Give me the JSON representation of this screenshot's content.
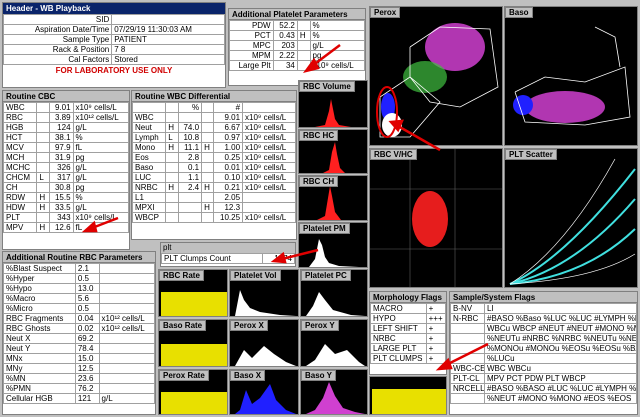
{
  "header": {
    "title": "Header - WB Playback",
    "rows": [
      {
        "label": "SID",
        "value": ""
      },
      {
        "label": "Aspiration Date/Time",
        "value": "07/29/19 11:30:03 AM"
      },
      {
        "label": "Sample Type",
        "value": "PATIENT"
      },
      {
        "label": "Rack & Position",
        "value": "7 8"
      },
      {
        "label": "Cal Factors",
        "value": "Stored"
      }
    ],
    "lab_only": "FOR LABORATORY USE ONLY"
  },
  "platelet_params": {
    "title": "Additional Platelet Parameters",
    "rows": [
      {
        "label": "PDW",
        "value": "52.2",
        "flag": "",
        "unit": "%"
      },
      {
        "label": "PCT",
        "value": "0.43",
        "flag": "H",
        "unit": "%"
      },
      {
        "label": "MPC",
        "value": "203",
        "flag": "",
        "unit": "g/L"
      },
      {
        "label": "MPM",
        "value": "2.22",
        "flag": "",
        "unit": "pg"
      },
      {
        "label": "Large Plt",
        "value": "34",
        "flag": "",
        "unit": "x10⁹ cells/L"
      }
    ]
  },
  "cbc": {
    "title": "Routine CBC",
    "rows": [
      {
        "label": "WBC",
        "flag": "",
        "value": "9.01",
        "unit": "x10⁹ cells/L"
      },
      {
        "label": "RBC",
        "flag": "",
        "value": "3.89",
        "unit": "x10¹² cells/L"
      },
      {
        "label": "HGB",
        "flag": "",
        "value": "124",
        "unit": "g/L"
      },
      {
        "label": "HCT",
        "flag": "",
        "value": "38.1",
        "unit": "%"
      },
      {
        "label": "MCV",
        "flag": "",
        "value": "97.9",
        "unit": "fL"
      },
      {
        "label": "MCH",
        "flag": "",
        "value": "31.9",
        "unit": "pg"
      },
      {
        "label": "MCHC",
        "flag": "",
        "value": "326",
        "unit": "g/L"
      },
      {
        "label": "CHCM",
        "flag": "L",
        "value": "317",
        "unit": "g/L"
      },
      {
        "label": "CH",
        "flag": "",
        "value": "30.8",
        "unit": "pg"
      },
      {
        "label": "RDW",
        "flag": "H",
        "value": "15.5",
        "unit": "%"
      },
      {
        "label": "HDW",
        "flag": "H",
        "value": "33.5",
        "unit": "g/L"
      },
      {
        "label": "PLT",
        "flag": "",
        "value": "343",
        "unit": "x10⁹ cells/L"
      },
      {
        "label": "MPV",
        "flag": "H",
        "value": "12.6",
        "unit": "fL"
      }
    ]
  },
  "wbc_diff": {
    "title": "Routine WBC Differential",
    "col_pct": "%",
    "col_abs": "#",
    "rows": [
      {
        "label": "WBC",
        "pflag": "",
        "pct": "",
        "aflag": "",
        "abs": "9.01",
        "unit": "x10⁹ cells/L"
      },
      {
        "label": "Neut",
        "pflag": "H",
        "pct": "74.0",
        "aflag": "",
        "abs": "6.67",
        "unit": "x10⁹ cells/L"
      },
      {
        "label": "Lymph",
        "pflag": "L",
        "pct": "10.8",
        "aflag": "",
        "abs": "0.97",
        "unit": "x10⁹ cells/L"
      },
      {
        "label": "Mono",
        "pflag": "H",
        "pct": "11.1",
        "aflag": "H",
        "abs": "1.00",
        "unit": "x10⁹ cells/L"
      },
      {
        "label": "Eos",
        "pflag": "",
        "pct": "2.8",
        "aflag": "",
        "abs": "0.25",
        "unit": "x10⁹ cells/L"
      },
      {
        "label": "Baso",
        "pflag": "",
        "pct": "0.1",
        "aflag": "",
        "abs": "0.01",
        "unit": "x10⁹ cells/L"
      },
      {
        "label": "LUC",
        "pflag": "",
        "pct": "1.1",
        "aflag": "",
        "abs": "0.10",
        "unit": "x10⁹ cells/L"
      },
      {
        "label": "NRBC",
        "pflag": "H",
        "pct": "2.4",
        "aflag": "H",
        "abs": "0.21",
        "unit": "x10⁹ cells/L"
      },
      {
        "label": "L1",
        "pflag": "",
        "pct": "",
        "aflag": "",
        "abs": "2.05",
        "unit": ""
      },
      {
        "label": "MPXI",
        "pflag": "",
        "pct": "",
        "aflag": "H",
        "abs": "12.3",
        "unit": ""
      },
      {
        "label": "WBCP",
        "pflag": "",
        "pct": "",
        "aflag": "",
        "abs": "10.25",
        "unit": "x10⁹ cells/L"
      }
    ]
  },
  "plt_clumps": {
    "title": "plt",
    "label": "PLT Clumps Count",
    "value": "1974"
  },
  "rbc_params": {
    "title": "Additional Routine RBC Parameters",
    "rows": [
      {
        "label": "%Blast Suspect",
        "value": "2.1",
        "unit": ""
      },
      {
        "label": "%Hyper",
        "value": "0.5",
        "unit": ""
      },
      {
        "label": "%Hypo",
        "value": "13.0",
        "unit": ""
      },
      {
        "label": "%Macro",
        "value": "5.6",
        "unit": ""
      },
      {
        "label": "%Micro",
        "value": "0.5",
        "unit": ""
      },
      {
        "label": "RBC Fragments",
        "value": "0.04",
        "unit": "x10¹² cells/L"
      },
      {
        "label": "RBC Ghosts",
        "value": "0.02",
        "unit": "x10¹² cells/L"
      },
      {
        "label": "Neut X",
        "value": "69.2",
        "unit": ""
      },
      {
        "label": "Neut Y",
        "value": "78.4",
        "unit": ""
      },
      {
        "label": "MNx",
        "value": "15.0",
        "unit": ""
      },
      {
        "label": "MNy",
        "value": "12.5",
        "unit": ""
      },
      {
        "label": "%MN",
        "value": "23.6",
        "unit": ""
      },
      {
        "label": "%PMN",
        "value": "76.2",
        "unit": ""
      },
      {
        "label": "Cellular HGB",
        "value": "121",
        "unit": "g/L"
      }
    ]
  },
  "plots": {
    "rbc_volume": "RBC Volume",
    "rbc_hc": "RBC HC",
    "rbc_ch": "RBC CH",
    "platelet_pm": "Platelet PM",
    "perox": "Perox",
    "baso": "Baso",
    "rbc_vhc": "RBC V/HC",
    "plt_scatter": "PLT Scatter",
    "rbc_rate": "RBC Rate",
    "platelet_vol": "Platelet Vol",
    "platelet_pc": "Platelet PC",
    "baso_rate": "Baso Rate",
    "perox_x": "Perox X",
    "perox_y": "Perox Y",
    "perox_rate": "Perox Rate",
    "baso_x": "Baso X",
    "baso_y": "Baso Y"
  },
  "morph_flags": {
    "title": "Morphology Flags",
    "rows": [
      {
        "label": "MACRO",
        "value": "+"
      },
      {
        "label": "HYPO",
        "value": "+++"
      },
      {
        "label": "LEFT SHIFT",
        "value": "+"
      },
      {
        "label": "NRBC",
        "value": "+"
      },
      {
        "label": "LARGE PLT",
        "value": "+"
      },
      {
        "label": "PLT CLUMPS",
        "value": "+"
      }
    ]
  },
  "sample_flags": {
    "title": "Sample/System Flags",
    "rows": [
      {
        "label": "B-NV",
        "value": "LI"
      },
      {
        "label": "N-RBC",
        "value": "#BASO %Baso %LUC %LUC #LYMPH %LYMPH"
      },
      {
        "label": "",
        "value": "WBCu WBCP #NEUT #NEUT #MONO %MONO"
      },
      {
        "label": "",
        "value": "%NEUTu #NRBC %NRBC %NEUTu %NEUTu %LYMPH"
      },
      {
        "label": "",
        "value": "%MONOu #MONOu %EOSu %EOSu %BASO"
      },
      {
        "label": "",
        "value": "%LUCu"
      },
      {
        "label": "WBC-CE",
        "value": "WBC WBCu"
      },
      {
        "label": "PLT-CL",
        "value": "MPV PCT PDW PLT WBCP"
      },
      {
        "label": "NRCELL",
        "value": "#BASO %BASO #LUC %LUC #LYMPH %LYMPH"
      },
      {
        "label": "",
        "value": "%NEUT #MONO %MONO #EOS %EOS"
      }
    ]
  },
  "colors": {
    "title_bar": "#0a246a",
    "arrow": "#e00000",
    "histogram": "#e8e000",
    "rbc": "#ff2020",
    "perox_magenta": "#d040d0"
  }
}
